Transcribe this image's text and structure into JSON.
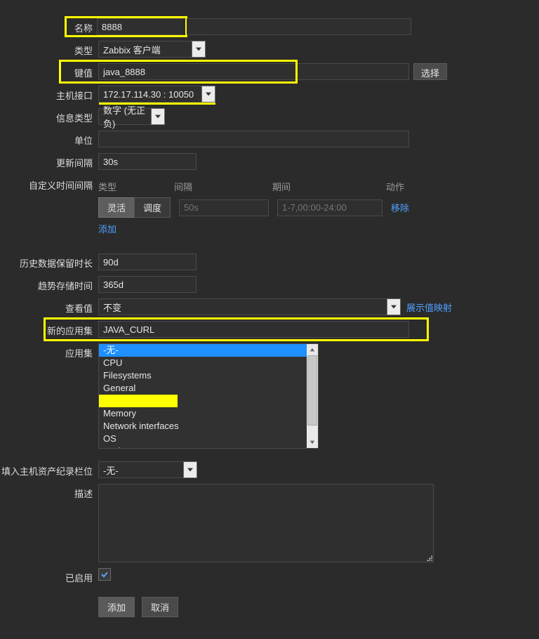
{
  "labels": {
    "name": "名称",
    "type": "类型",
    "key": "键值",
    "host_if": "主机接口",
    "info_type": "信息类型",
    "unit": "单位",
    "upd_int": "更新间隔",
    "cust_int": "自定义时间间隔",
    "hist": "历史数据保留时长",
    "trend": "趋势存储时间",
    "view_val": "查看值",
    "new_app": "新的应用集",
    "app": "应用集",
    "inv": "填入主机资产纪录栏位",
    "desc": "描述",
    "enabled": "已启用"
  },
  "fields": {
    "name": "8888",
    "type": "Zabbix 客户端",
    "key": "java_8888",
    "key_btn": "选择",
    "host_if": "172.17.114.30 : 10050",
    "info_type": "数字 (无正负)",
    "unit": "",
    "upd_int": "30s",
    "hist": "90d",
    "trend": "365d",
    "view_val": "不变",
    "view_val_link": "展示值映射",
    "new_app": "JAVA_CURL",
    "inv": "-无-",
    "desc": ""
  },
  "custom_interval": {
    "head_type": "类型",
    "head_int": "间隔",
    "head_period": "期间",
    "head_action": "动作",
    "tab_active": "灵活",
    "tab_other": "调度",
    "int_ph": "50s",
    "period_ph": "1-7,00:00-24:00",
    "remove": "移除",
    "add": "添加"
  },
  "apps": {
    "items": [
      "-无-",
      "CPU",
      "Filesystems",
      "General",
      "",
      "Memory",
      "Network interfaces",
      "OS",
      "Performance",
      ""
    ],
    "selected": 0,
    "highlighted": 4
  },
  "buttons": {
    "add": "添加",
    "cancel": "取消"
  }
}
